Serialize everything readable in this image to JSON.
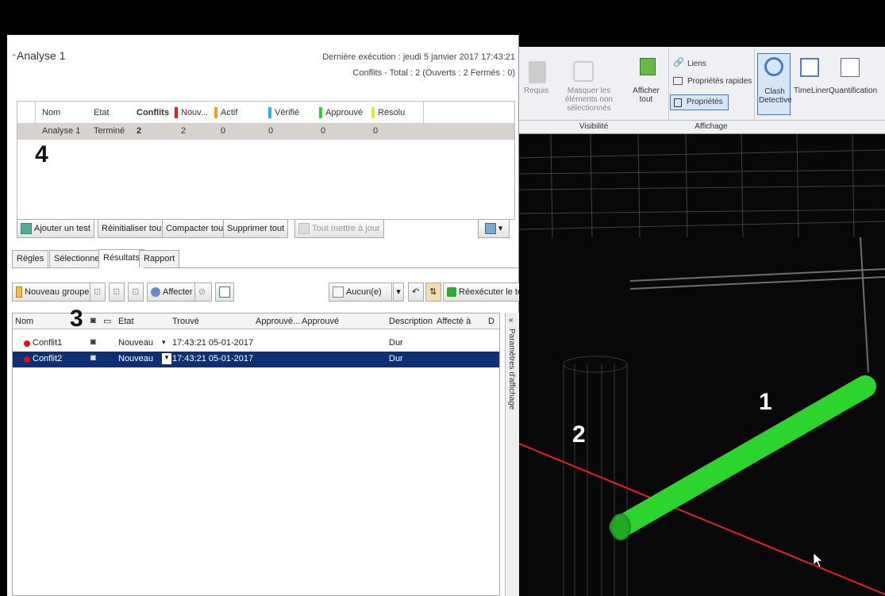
{
  "panel": {
    "title": "Analyse 1",
    "last_exec": "Dernière exécution : jeudi 5 janvier 2017 17:43:21",
    "conflicts_summary": "Conflits - Total : 2 (Ouverts : 2 Fermés : 0)"
  },
  "tests_table": {
    "headers": [
      "Nom",
      "Etat",
      "Conflits",
      "Nouv...",
      "Actif",
      "Vérifié",
      "Approuvé",
      "Résolu"
    ],
    "header_colors": {
      "Nouv...": "#e02020",
      "Actif": "#f0a020",
      "Vérifié": "#30b0e0",
      "Approuvé": "#30d030",
      "Résolu": "#f0e040"
    },
    "row": [
      "Analyse 1",
      "Terminé",
      "2",
      "2",
      "0",
      "0",
      "0",
      "0"
    ]
  },
  "annotations": {
    "n4": "4",
    "n3": "3",
    "n2": "2",
    "n1": "1"
  },
  "toolbar": {
    "add_test": "Ajouter un test",
    "reset_all": "Réinitialiser tout",
    "compact_all": "Compacter tout",
    "delete_all": "Supprimer tout",
    "update_all": "Tout mettre à jour"
  },
  "tabs": [
    "Règles",
    "Sélectionner",
    "Résultats",
    "Rapport"
  ],
  "results_toolbar": {
    "new_group": "Nouveau groupe",
    "assign": "Affecter",
    "none_select": "Aucun(e)",
    "rerun": "Réexécuter le test"
  },
  "results_table": {
    "headers": [
      "Nom",
      "Etat",
      "Trouvé",
      "Approuvé...",
      "Approuvé",
      "Description",
      "Affecté à",
      "D"
    ],
    "rows": [
      {
        "name": "Conflit1",
        "state": "Nouveau",
        "found": "17:43:21 05-01-2017",
        "desc": "Dur"
      },
      {
        "name": "Conflit2",
        "state": "Nouveau",
        "found": "17:43:21 05-01-2017",
        "desc": "Dur"
      }
    ]
  },
  "side_panel_label": "Paramètres d'affichage",
  "ribbon": {
    "requis": "Requis",
    "hide_unselected": "Masquer les éléments non sélectionnés",
    "show_all": "Afficher tout",
    "links": "Liens",
    "quick_props": "Propriétés rapides",
    "properties": "Propriétés",
    "clash": "Clash Detective",
    "timeliner": "TimeLiner",
    "quantification": "Quantification",
    "group_visibility": "Visibilité",
    "group_display": "Affichage"
  }
}
